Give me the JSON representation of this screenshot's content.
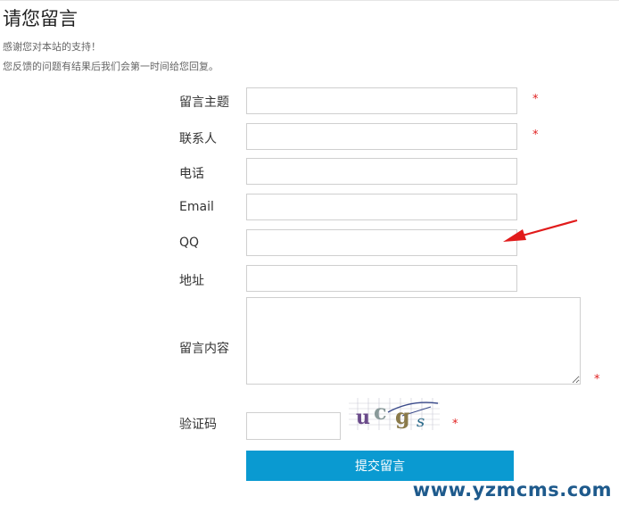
{
  "page": {
    "title": "请您留言",
    "intro_line1": "感谢您对本站的支持！",
    "intro_line2": "您反馈的问题有结果后我们会第一时间给您回复。"
  },
  "form": {
    "fields": [
      {
        "label": "留言主题",
        "value": "",
        "required": true
      },
      {
        "label": "联系人",
        "value": "",
        "required": true
      },
      {
        "label": "电话",
        "value": "",
        "required": false
      },
      {
        "label": "Email",
        "value": "",
        "required": false
      },
      {
        "label": "QQ",
        "value": "",
        "required": false
      },
      {
        "label": "地址",
        "value": "",
        "required": false
      }
    ],
    "content": {
      "label": "留言内容",
      "value": "",
      "required": true
    },
    "captcha": {
      "label": "验证码",
      "value": "",
      "required": true,
      "image_text": "ucgs"
    },
    "required_mark": "*",
    "submit_label": "提交留言"
  },
  "annotation": {
    "arrow_color": "#e11b1b",
    "target": "QQ"
  },
  "watermark": "www.yzmcms.com",
  "colors": {
    "accent": "#0a9ad1",
    "required": "#e02020",
    "watermark": "#1e5a8c"
  }
}
